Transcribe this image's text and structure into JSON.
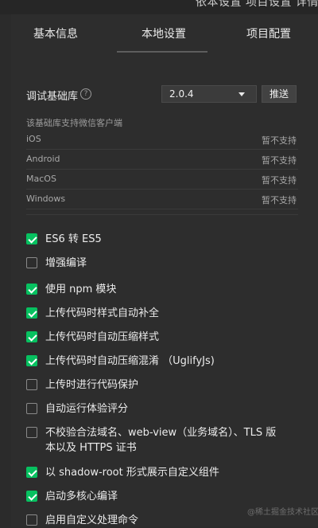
{
  "top_strip_text": "依本设置  项目设置  详情",
  "tabs": [
    {
      "label": "基本信息"
    },
    {
      "label": "本地设置"
    },
    {
      "label": "项目配置"
    }
  ],
  "library": {
    "label": "调试基础库",
    "help_icon": "question-circle-icon",
    "version": "2.0.4",
    "push_label": "推送"
  },
  "support": {
    "title": "该基础库支持微信客户端",
    "clients": [
      {
        "name": "iOS",
        "status": "暂不支持"
      },
      {
        "name": "Android",
        "status": "暂不支持"
      },
      {
        "name": "MacOS",
        "status": "暂不支持"
      },
      {
        "name": "Windows",
        "status": "暂不支持"
      }
    ]
  },
  "options": [
    {
      "label": "ES6 转 ES5",
      "checked": true
    },
    {
      "label": "增强编译",
      "checked": false
    },
    {
      "label": "使用 npm 模块",
      "checked": true
    },
    {
      "label": "上传代码时样式自动补全",
      "checked": true
    },
    {
      "label": "上传代码时自动压缩样式",
      "checked": true
    },
    {
      "label": "上传代码时自动压缩混淆 （UglifyJs)",
      "checked": true
    },
    {
      "label": "上传时进行代码保护",
      "checked": false
    },
    {
      "label": "自动运行体验评分",
      "checked": false
    },
    {
      "label": "不校验合法域名、web-view（业务域名）、TLS 版本以及 HTTPS 证书",
      "checked": false
    },
    {
      "label": "以 shadow-root 形式展示自定义组件",
      "checked": true
    },
    {
      "label": "启动多核心编译",
      "checked": true
    },
    {
      "label": "启用自定义处理命令",
      "checked": false
    }
  ],
  "watermark": "@稀土掘金技术社区",
  "colors": {
    "accent": "#07c160",
    "background": "#2d2d2d"
  }
}
